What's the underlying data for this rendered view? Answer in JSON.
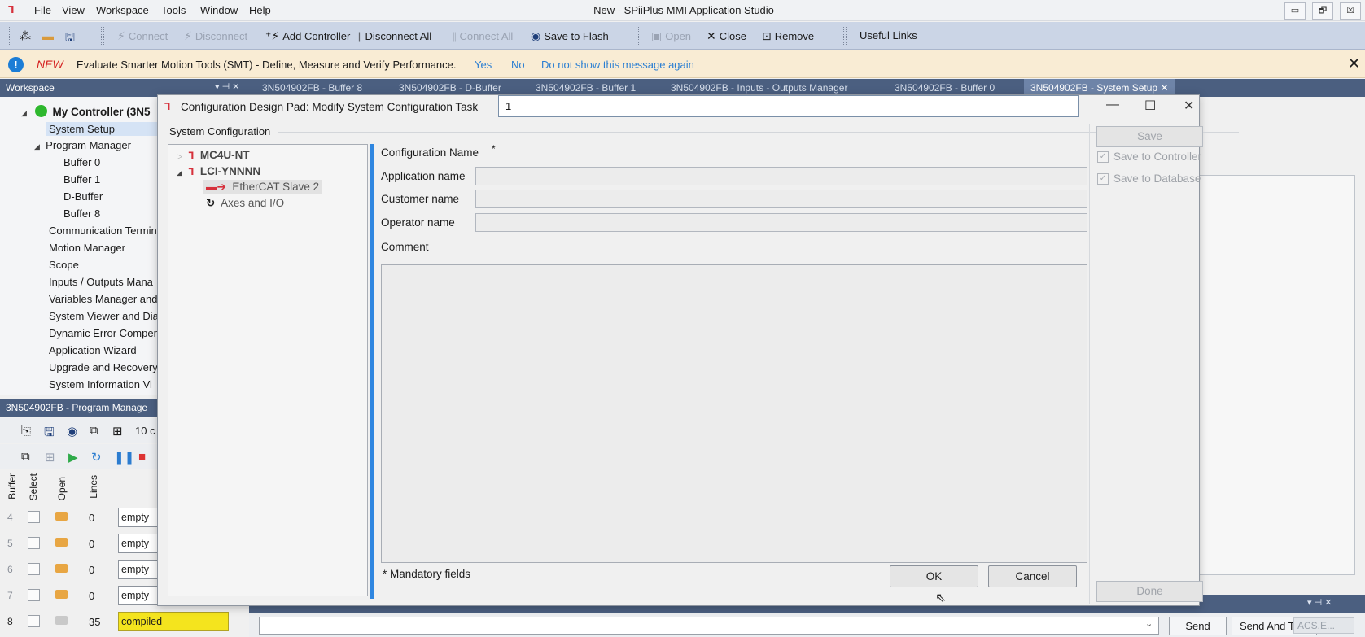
{
  "app": {
    "title": "New - SPiiPlus MMI Application Studio",
    "menu": [
      "File",
      "View",
      "Workspace",
      "Tools",
      "Window",
      "Help"
    ],
    "window_buttons": [
      "▭",
      "🗗",
      "☒"
    ]
  },
  "toolbar": {
    "connect": "Connect",
    "disconnect": "Disconnect",
    "add_controller": "Add Controller",
    "disconnect_all": "Disconnect All",
    "connect_all": "Connect All",
    "save_to_flash": "Save to Flash",
    "open": "Open",
    "close": "Close",
    "remove": "Remove",
    "useful_links": "Useful Links"
  },
  "notification": {
    "tag": "NEW",
    "message": "Evaluate Smarter Motion Tools (SMT) - Define, Measure and Verify Performance.",
    "yes": "Yes",
    "no": "No",
    "dont_show": "Do not show this message again",
    "close": "✕"
  },
  "workspace": {
    "title": "Workspace",
    "pane_buttons": "▾ ⊣ ✕",
    "controller": "My Controller (3N5",
    "items": [
      "System Setup",
      "Program Manager",
      "Buffer 0",
      "Buffer 1",
      "D-Buffer",
      "Buffer 8",
      "Communication Termin",
      "Motion Manager",
      "Scope",
      "Inputs / Outputs Mana",
      "Variables Manager and",
      "System Viewer and Dia",
      "Dynamic Error Compen",
      "Application Wizard",
      "Upgrade and Recovery",
      "System Information Vi"
    ]
  },
  "program_manager": {
    "title": "3N504902FB - Program Manage",
    "lines_dropdown": "10 c",
    "columns": [
      "Buffer",
      "Select",
      "Open",
      "Lines"
    ],
    "rows": [
      {
        "buffer": "4",
        "lines": "0",
        "status": "empty"
      },
      {
        "buffer": "5",
        "lines": "0",
        "status": "empty"
      },
      {
        "buffer": "6",
        "lines": "0",
        "status": "empty"
      },
      {
        "buffer": "7",
        "lines": "0",
        "status": "empty"
      },
      {
        "buffer": "8",
        "lines": "35",
        "status": "compiled"
      }
    ]
  },
  "doc_tabs": [
    "3N504902FB - Buffer 8",
    "3N504902FB - D-Buffer",
    "3N504902FB - Buffer 1",
    "3N504902FB - Inputs - Outputs Manager",
    "3N504902FB - Buffer 0",
    "3N504902FB - System Setup"
  ],
  "command_bar": {
    "send": "Send",
    "send_and": "Send And T",
    "acs": "ACS.E..."
  },
  "dialog": {
    "title": "Configuration Design Pad: Modify System Configuration Task",
    "section": "System Configuration",
    "tree": {
      "mc4u": "MC4U-NT",
      "lci": "LCI-YNNNN",
      "ethercat": "EtherCAT Slave 2",
      "axes_io": "Axes and I/O"
    },
    "fields": {
      "config_name_label": "Configuration Name",
      "config_name_value": "1",
      "required_mark": "*",
      "application_name_label": "Application name",
      "customer_name_label": "Customer name",
      "operator_name_label": "Operator name",
      "comment_label": "Comment"
    },
    "mandatory_note": "* Mandatory fields",
    "ok": "OK",
    "cancel": "Cancel",
    "save": "Save",
    "save_to_controller": "Save to Controller",
    "save_to_database": "Save to Database",
    "done": "Done"
  }
}
